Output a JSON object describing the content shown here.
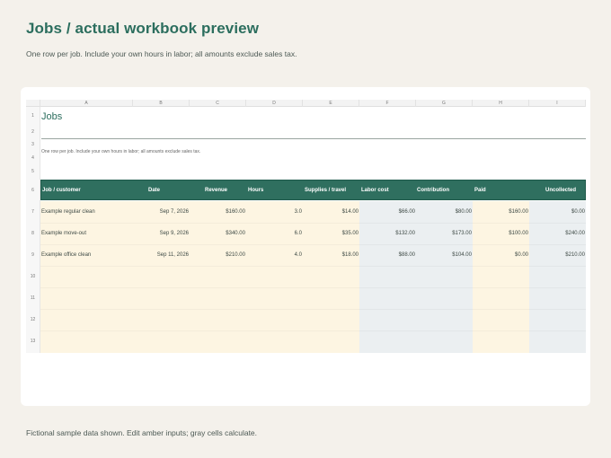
{
  "page": {
    "title": "Jobs / actual workbook preview",
    "subtitle": "One row per job. Include your own hours in labor; all amounts exclude sales tax.",
    "footer": "Fictional sample data shown. Edit amber inputs; gray cells calculate."
  },
  "sheet": {
    "columns": [
      "A",
      "B",
      "C",
      "D",
      "E",
      "F",
      "G",
      "H",
      "I"
    ],
    "row_numbers": [
      "1",
      "2",
      "3",
      "4",
      "5",
      "6",
      "7",
      "8",
      "9",
      "10",
      "11",
      "12",
      "13"
    ],
    "title": "Jobs",
    "note": "One row per job. Include your own hours in labor; all amounts exclude sales tax.",
    "headers": [
      "Job / customer",
      "Date",
      "Revenue",
      "Hours",
      "Supplies / travel",
      "Labor cost",
      "Contribution",
      "Paid",
      "Uncollected"
    ],
    "rows": [
      [
        "Example regular clean",
        "Sep 7, 2026",
        "$160.00",
        "3.0",
        "$14.00",
        "$66.00",
        "$80.00",
        "$160.00",
        "$0.00"
      ],
      [
        "Example move-out",
        "Sep 9, 2026",
        "$340.00",
        "6.0",
        "$35.00",
        "$132.00",
        "$173.00",
        "$100.00",
        "$240.00"
      ],
      [
        "Example office clean",
        "Sep 11, 2026",
        "$210.00",
        "4.0",
        "$18.00",
        "$88.00",
        "$104.00",
        "$0.00",
        "$210.00"
      ]
    ]
  },
  "colors": {
    "accent": "#2f6f5f",
    "input_fill": "#fdf5e2",
    "calc_fill": "#ebeff1"
  }
}
